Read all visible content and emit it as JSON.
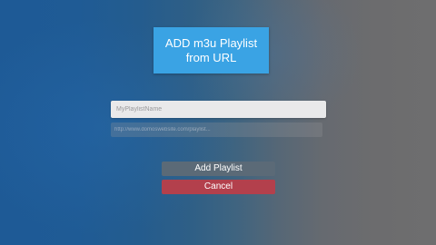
{
  "dialog": {
    "title_line1": "ADD m3u Playlist",
    "title_line2": "from URL"
  },
  "form": {
    "name_placeholder": "MyPlaylistName",
    "url_placeholder": "http://www.domoswebsite.com/playlist..."
  },
  "actions": {
    "add_label": "Add Playlist",
    "cancel_label": "Cancel"
  },
  "colors": {
    "accent": "#3aa3e4",
    "cancel": "#b3404c",
    "background_left": "#1e5a96",
    "background_right": "#6e6e6f"
  }
}
